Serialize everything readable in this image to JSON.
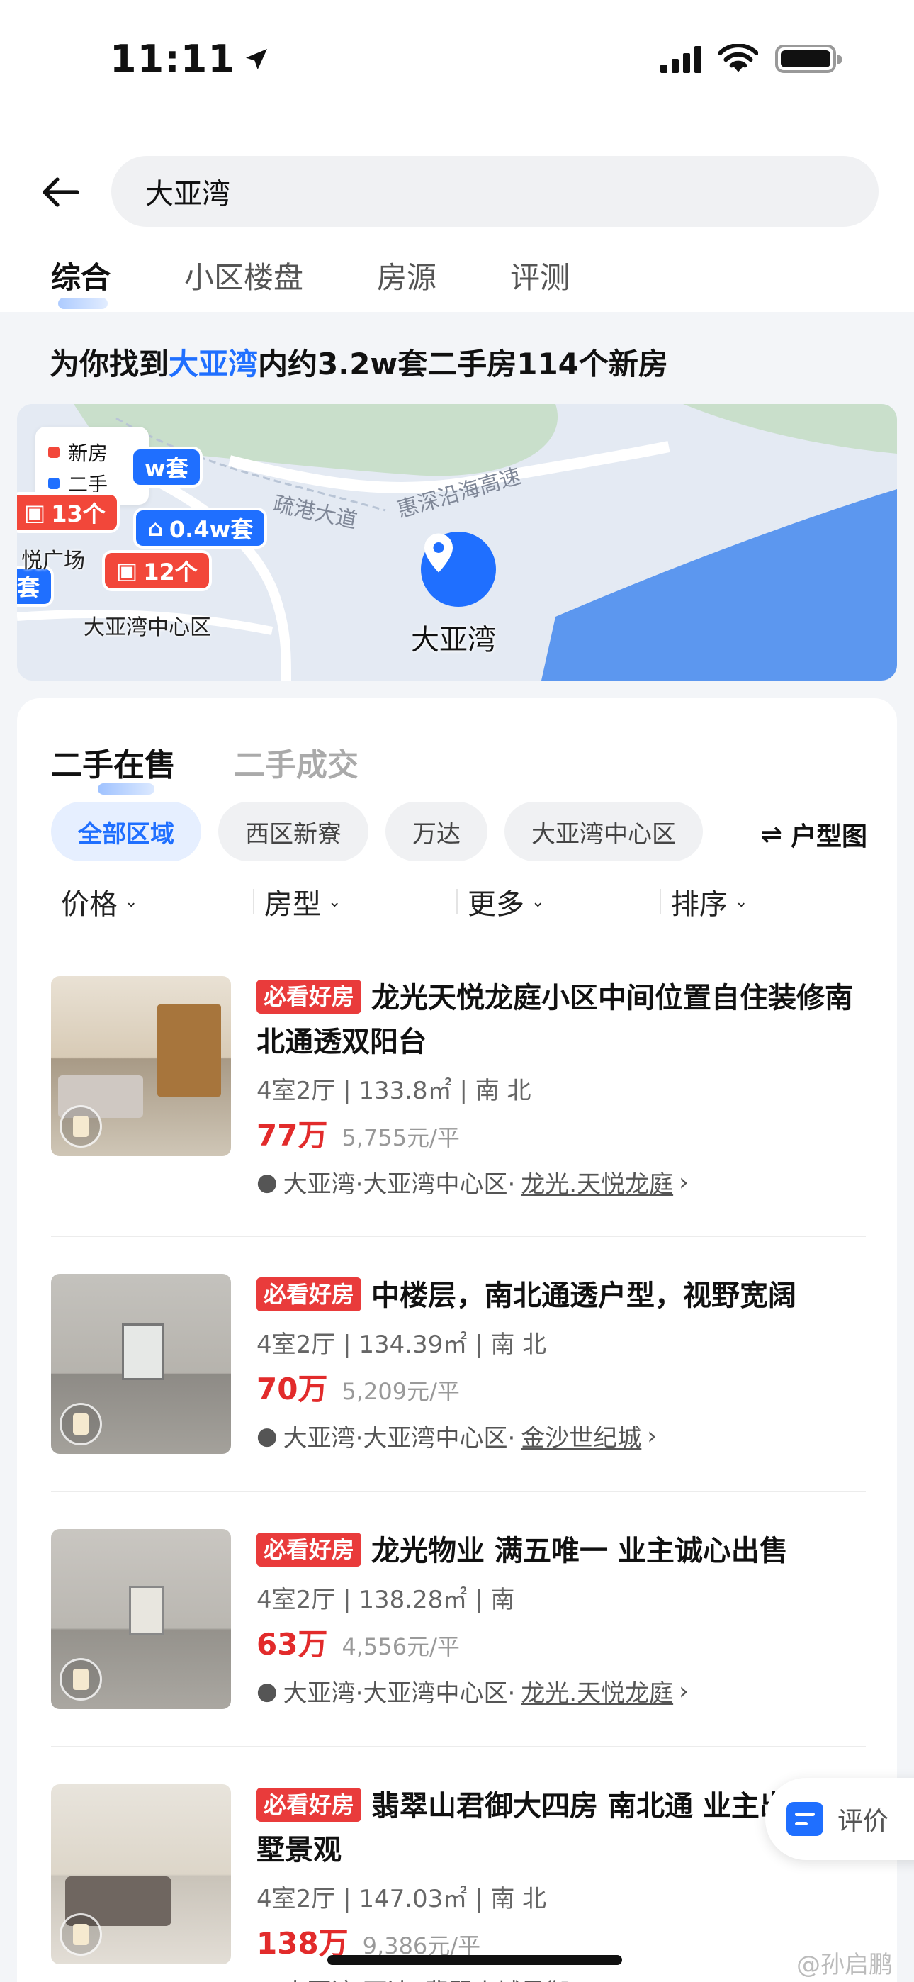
{
  "status": {
    "time": "11:11"
  },
  "search": {
    "value": "大亚湾"
  },
  "tabs": [
    "综合",
    "小区楼盘",
    "房源",
    "评测"
  ],
  "result": {
    "prefix": "为你找到",
    "keyword": "大亚湾",
    "suffix": "内约3.2w套二手房114个新房"
  },
  "map": {
    "legend": [
      "新房",
      "二手"
    ],
    "pills": [
      "0.4w套",
      "12个",
      "13个",
      "w套",
      "套"
    ],
    "labels": [
      "大亚湾中心区",
      "疏港大道",
      "惠深沿海高速",
      "悦广场"
    ],
    "pin_label": "大亚湾"
  },
  "listings_section": {
    "tabs": [
      "二手在售",
      "二手成交"
    ],
    "chips": [
      "全部区域",
      "西区新寮",
      "万达",
      "大亚湾中心区"
    ],
    "layout_button": "户型图",
    "filters": [
      "价格",
      "房型",
      "更多",
      "排序"
    ]
  },
  "listings": [
    {
      "tag": "必看好房",
      "title": "龙光天悦龙庭小区中间位置自住装修南北通透双阳台",
      "meta": "4室2厅 | 133.8㎡ | 南 北",
      "price": "77万",
      "unit_price": "5,755元/平",
      "loc_prefix": "大亚湾·大亚湾中心区·",
      "loc_link": "龙光.天悦龙庭"
    },
    {
      "tag": "必看好房",
      "title": "中楼层，南北通透户型，视野宽阔",
      "meta": "4室2厅 | 134.39㎡ | 南 北",
      "price": "70万",
      "unit_price": "5,209元/平",
      "loc_prefix": "大亚湾·大亚湾中心区·",
      "loc_link": "金沙世纪城"
    },
    {
      "tag": "必看好房",
      "title": "龙光物业  满五唯一 业主诚心出售",
      "meta": "4室2厅 | 138.28㎡ | 南",
      "price": "63万",
      "unit_price": "4,556元/平",
      "loc_prefix": "大亚湾·大亚湾中心区·",
      "loc_link": "龙光.天悦龙庭"
    },
    {
      "tag": "必看好房",
      "title": "翡翠山君御大四房 南北通 业主出售 别墅景观",
      "meta": "4室2厅 | 147.03㎡ | 南 北",
      "price": "138万",
      "unit_price": "9,386元/平",
      "loc_prefix": "大亚湾·万达·",
      "loc_link": "翡翠山城君御"
    }
  ],
  "float": {
    "eval_label": "评价"
  },
  "watermark": "@孙启鹏",
  "colors": {
    "accent": "#1f6fff",
    "price_red": "#e22b2b",
    "tag_red": "#e93b3b"
  }
}
